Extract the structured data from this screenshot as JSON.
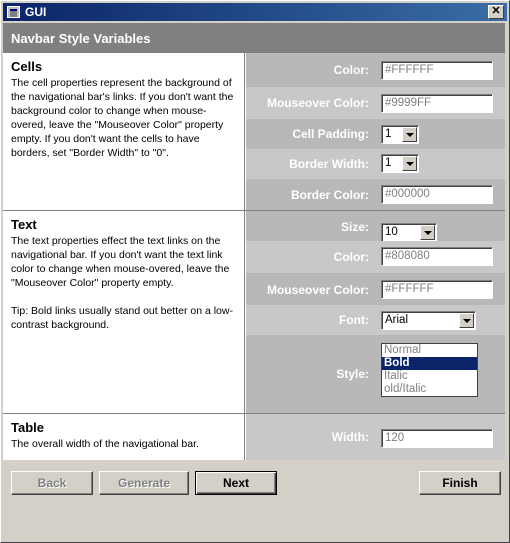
{
  "window": {
    "title": "GUI",
    "close_label": "✕"
  },
  "header": {
    "title": "Navbar Style Variables"
  },
  "sections": {
    "cells": {
      "heading": "Cells",
      "description": "The cell properties represent the background of the navigational bar's links. If you don't want the background color to change when mouse-overed, leave the \"Mouseover Color\" property empty. If you don't want the cells to have borders, set \"Border Width\" to \"0\".",
      "color_label": "Color:",
      "color_value": "#FFFFFF",
      "mouseover_label": "Mouseover Color:",
      "mouseover_value": "#9999FF",
      "padding_label": "Cell Padding:",
      "padding_value": "1",
      "border_width_label": "Border Width:",
      "border_width_value": "1",
      "border_color_label": "Border Color:",
      "border_color_value": "#000000"
    },
    "text": {
      "heading": "Text",
      "description": "The text properties effect the text links on the navigational bar. If you don't want the text link color to change when mouse-overed, leave the \"Mouseover Color\" property empty.",
      "tip": "Tip: Bold links usually stand out better on a low-contrast background.",
      "size_label": "Size:",
      "size_value": "10",
      "color_label": "Color:",
      "color_value": "#808080",
      "mouseover_label": "Mouseover Color:",
      "mouseover_value": "#FFFFFF",
      "font_label": "Font:",
      "font_value": "Arial",
      "style_label": "Style:",
      "style_options": [
        "Normal",
        "Bold",
        "Italic",
        "old/Italic"
      ]
    },
    "table": {
      "heading": "Table",
      "description": "The overall width of the navigational bar.",
      "width_label": "Width:",
      "width_value": "120"
    }
  },
  "buttons": {
    "back": "Back",
    "generate": "Generate",
    "next": "Next",
    "finish": "Finish"
  },
  "colors": {
    "titlebar": "#0a246a",
    "header": "#808080",
    "selection": "#0a246a"
  },
  "icons": {
    "app": "app-window-icon",
    "close": "close-icon"
  }
}
